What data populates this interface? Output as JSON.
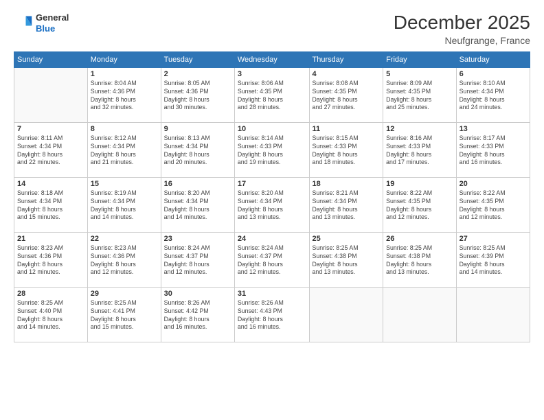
{
  "logo": {
    "line1": "General",
    "line2": "Blue"
  },
  "title": "December 2025",
  "location": "Neufgrange, France",
  "days_of_week": [
    "Sunday",
    "Monday",
    "Tuesday",
    "Wednesday",
    "Thursday",
    "Friday",
    "Saturday"
  ],
  "weeks": [
    [
      {
        "day": "",
        "info": ""
      },
      {
        "day": "1",
        "info": "Sunrise: 8:04 AM\nSunset: 4:36 PM\nDaylight: 8 hours\nand 32 minutes."
      },
      {
        "day": "2",
        "info": "Sunrise: 8:05 AM\nSunset: 4:36 PM\nDaylight: 8 hours\nand 30 minutes."
      },
      {
        "day": "3",
        "info": "Sunrise: 8:06 AM\nSunset: 4:35 PM\nDaylight: 8 hours\nand 28 minutes."
      },
      {
        "day": "4",
        "info": "Sunrise: 8:08 AM\nSunset: 4:35 PM\nDaylight: 8 hours\nand 27 minutes."
      },
      {
        "day": "5",
        "info": "Sunrise: 8:09 AM\nSunset: 4:35 PM\nDaylight: 8 hours\nand 25 minutes."
      },
      {
        "day": "6",
        "info": "Sunrise: 8:10 AM\nSunset: 4:34 PM\nDaylight: 8 hours\nand 24 minutes."
      }
    ],
    [
      {
        "day": "7",
        "info": "Sunrise: 8:11 AM\nSunset: 4:34 PM\nDaylight: 8 hours\nand 22 minutes."
      },
      {
        "day": "8",
        "info": "Sunrise: 8:12 AM\nSunset: 4:34 PM\nDaylight: 8 hours\nand 21 minutes."
      },
      {
        "day": "9",
        "info": "Sunrise: 8:13 AM\nSunset: 4:34 PM\nDaylight: 8 hours\nand 20 minutes."
      },
      {
        "day": "10",
        "info": "Sunrise: 8:14 AM\nSunset: 4:33 PM\nDaylight: 8 hours\nand 19 minutes."
      },
      {
        "day": "11",
        "info": "Sunrise: 8:15 AM\nSunset: 4:33 PM\nDaylight: 8 hours\nand 18 minutes."
      },
      {
        "day": "12",
        "info": "Sunrise: 8:16 AM\nSunset: 4:33 PM\nDaylight: 8 hours\nand 17 minutes."
      },
      {
        "day": "13",
        "info": "Sunrise: 8:17 AM\nSunset: 4:33 PM\nDaylight: 8 hours\nand 16 minutes."
      }
    ],
    [
      {
        "day": "14",
        "info": "Sunrise: 8:18 AM\nSunset: 4:34 PM\nDaylight: 8 hours\nand 15 minutes."
      },
      {
        "day": "15",
        "info": "Sunrise: 8:19 AM\nSunset: 4:34 PM\nDaylight: 8 hours\nand 14 minutes."
      },
      {
        "day": "16",
        "info": "Sunrise: 8:20 AM\nSunset: 4:34 PM\nDaylight: 8 hours\nand 14 minutes."
      },
      {
        "day": "17",
        "info": "Sunrise: 8:20 AM\nSunset: 4:34 PM\nDaylight: 8 hours\nand 13 minutes."
      },
      {
        "day": "18",
        "info": "Sunrise: 8:21 AM\nSunset: 4:34 PM\nDaylight: 8 hours\nand 13 minutes."
      },
      {
        "day": "19",
        "info": "Sunrise: 8:22 AM\nSunset: 4:35 PM\nDaylight: 8 hours\nand 12 minutes."
      },
      {
        "day": "20",
        "info": "Sunrise: 8:22 AM\nSunset: 4:35 PM\nDaylight: 8 hours\nand 12 minutes."
      }
    ],
    [
      {
        "day": "21",
        "info": "Sunrise: 8:23 AM\nSunset: 4:36 PM\nDaylight: 8 hours\nand 12 minutes."
      },
      {
        "day": "22",
        "info": "Sunrise: 8:23 AM\nSunset: 4:36 PM\nDaylight: 8 hours\nand 12 minutes."
      },
      {
        "day": "23",
        "info": "Sunrise: 8:24 AM\nSunset: 4:37 PM\nDaylight: 8 hours\nand 12 minutes."
      },
      {
        "day": "24",
        "info": "Sunrise: 8:24 AM\nSunset: 4:37 PM\nDaylight: 8 hours\nand 12 minutes."
      },
      {
        "day": "25",
        "info": "Sunrise: 8:25 AM\nSunset: 4:38 PM\nDaylight: 8 hours\nand 13 minutes."
      },
      {
        "day": "26",
        "info": "Sunrise: 8:25 AM\nSunset: 4:38 PM\nDaylight: 8 hours\nand 13 minutes."
      },
      {
        "day": "27",
        "info": "Sunrise: 8:25 AM\nSunset: 4:39 PM\nDaylight: 8 hours\nand 14 minutes."
      }
    ],
    [
      {
        "day": "28",
        "info": "Sunrise: 8:25 AM\nSunset: 4:40 PM\nDaylight: 8 hours\nand 14 minutes."
      },
      {
        "day": "29",
        "info": "Sunrise: 8:25 AM\nSunset: 4:41 PM\nDaylight: 8 hours\nand 15 minutes."
      },
      {
        "day": "30",
        "info": "Sunrise: 8:26 AM\nSunset: 4:42 PM\nDaylight: 8 hours\nand 16 minutes."
      },
      {
        "day": "31",
        "info": "Sunrise: 8:26 AM\nSunset: 4:43 PM\nDaylight: 8 hours\nand 16 minutes."
      },
      {
        "day": "",
        "info": ""
      },
      {
        "day": "",
        "info": ""
      },
      {
        "day": "",
        "info": ""
      }
    ]
  ]
}
